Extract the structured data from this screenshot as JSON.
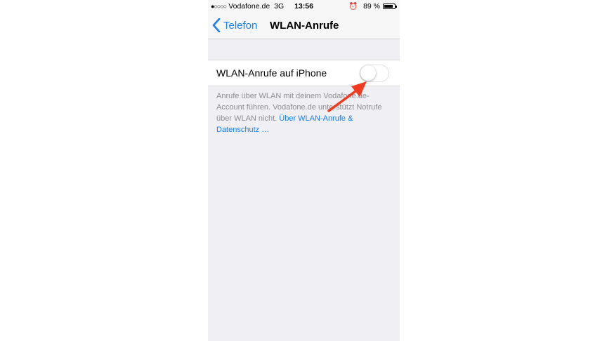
{
  "status_bar": {
    "carrier": "Vodafone.de",
    "network": "3G",
    "time": "13:56",
    "battery_percent": "89 %",
    "battery_level": 0.89,
    "signal_glyph": "●○○○○",
    "alarm_glyph": "⏰"
  },
  "nav_bar": {
    "back_label": "Telefon",
    "title": "WLAN-Anrufe",
    "back_icon": "chevron-left-icon"
  },
  "settings": {
    "wifi_calling_label": "WLAN-Anrufe auf iPhone",
    "wifi_calling_enabled": false
  },
  "footer": {
    "description": "Anrufe über WLAN mit deinem Vodafone.de-Account führen. Vodafone.de unterstützt Notrufe über WLAN nicht. ",
    "link": "Über WLAN-Anrufe & Datenschutz …"
  },
  "colors": {
    "accent": "#1a7ff5",
    "background": "#efeff4",
    "annotation_arrow": "#f23a1f"
  }
}
